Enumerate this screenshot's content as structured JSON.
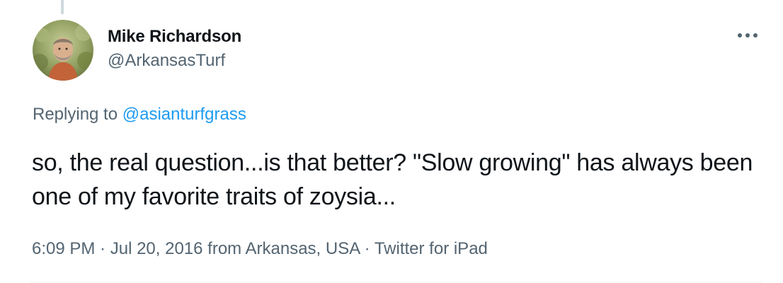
{
  "colors": {
    "text_primary": "#0f1419",
    "text_secondary": "#536471",
    "link": "#1d9bf0",
    "divider": "#eff3f4"
  },
  "tweet": {
    "author": {
      "display_name": "Mike Richardson",
      "handle": "@ArkansasTurf",
      "avatar_icon": "avatar-photo"
    },
    "more_icon": "more-options-icon",
    "replying_to": {
      "prefix": "Replying to ",
      "mention": "@asianturfgrass"
    },
    "text": "so, the real question...is that better? \"Slow growing\" has always been one of my favorite traits of zoysia...",
    "meta": {
      "time": "6:09 PM",
      "sep1": " · ",
      "date": "Jul 20, 2016",
      "from": " from ",
      "location": "Arkansas, USA",
      "sep2": " · ",
      "source": "Twitter for iPad"
    }
  }
}
